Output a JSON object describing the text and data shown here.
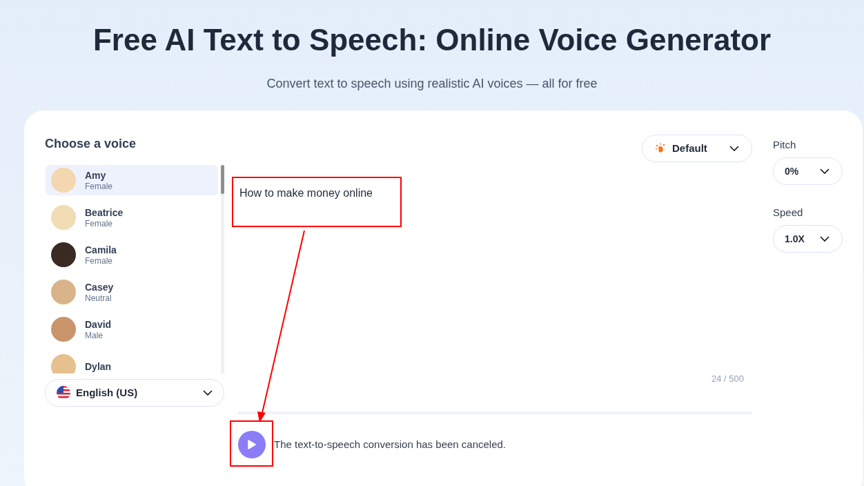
{
  "header": {
    "title": "Free AI Text to Speech: Online Voice Generator",
    "subtitle": "Convert text to speech using realistic AI voices — all for free"
  },
  "voice_panel": {
    "heading": "Choose a voice",
    "voices": [
      {
        "name": "Amy",
        "gender": "Female",
        "selected": true
      },
      {
        "name": "Beatrice",
        "gender": "Female",
        "selected": false
      },
      {
        "name": "Camila",
        "gender": "Female",
        "selected": false
      },
      {
        "name": "Casey",
        "gender": "Neutral",
        "selected": false
      },
      {
        "name": "David",
        "gender": "Male",
        "selected": false
      },
      {
        "name": "Dylan",
        "selected": false
      }
    ],
    "language": "English (US)"
  },
  "style_dropdown": "Default",
  "text_input": {
    "value": "How to make money online",
    "counter": "24 / 500"
  },
  "pitch": {
    "label": "Pitch",
    "value": "0%"
  },
  "speed": {
    "label": "Speed",
    "value": "1.0X"
  },
  "status": "The text-to-speech conversion has been canceled."
}
